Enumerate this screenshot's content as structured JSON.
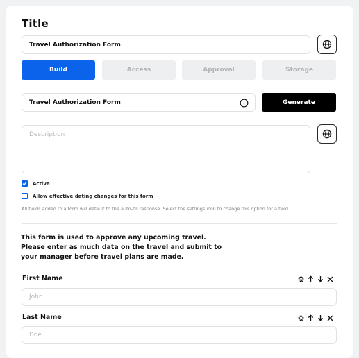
{
  "form": {
    "title_label": "Title",
    "title_value": "Travel Authorization Form",
    "tabs": [
      {
        "label": "Build",
        "active": true
      },
      {
        "label": "Access",
        "active": false
      },
      {
        "label": "Approval",
        "active": false
      },
      {
        "label": "Storage",
        "active": false
      }
    ],
    "name_value": "Travel Authorization Form",
    "generate_label": "Generate",
    "description_placeholder": "Description",
    "active_label": "Active",
    "active_checked": true,
    "dating_label": "Allow effective dating changes for this form",
    "dating_checked": false,
    "note": "All fields added to a form will default to the auto-fill response. Select the settings icon to change this option for a field.",
    "intro_text": "This form is used to approve any upcoming travel. Please enter as much data on the travel and submit to your manager before travel plans are made.",
    "fields": [
      {
        "label": "First Name",
        "placeholder": "John"
      },
      {
        "label": "Last Name",
        "placeholder": "Doe"
      }
    ]
  },
  "colors": {
    "accent": "#0a63ea",
    "generate_bg": "#000000",
    "tab_inactive_bg": "#eeeff1"
  },
  "icons": [
    "globe-icon",
    "info-icon",
    "gear-icon",
    "arrow-up-icon",
    "arrow-down-icon",
    "close-icon",
    "checkmark-icon"
  ]
}
